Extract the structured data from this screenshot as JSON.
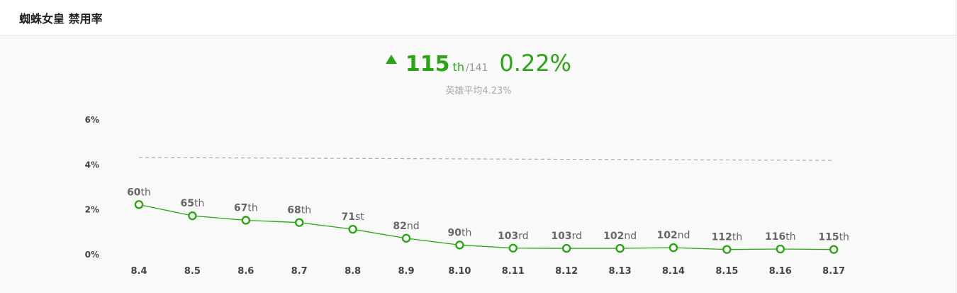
{
  "header": {
    "title": "蜘蛛女皇 禁用率"
  },
  "summary": {
    "rank": "115",
    "rank_suffix": "th",
    "total": "/141",
    "rate": "0.22%",
    "average": "英雄平均4.23%",
    "trend_icon": "up-triangle-icon",
    "accent_color": "#2aa514"
  },
  "chart_data": {
    "type": "line",
    "categories": [
      "8.4",
      "8.5",
      "8.6",
      "8.7",
      "8.8",
      "8.9",
      "8.10",
      "8.11",
      "8.12",
      "8.13",
      "8.14",
      "8.15",
      "8.16",
      "8.17"
    ],
    "series": [
      {
        "values": [
          2.2,
          1.7,
          1.5,
          1.4,
          1.1,
          0.7,
          0.4,
          0.26,
          0.25,
          0.25,
          0.28,
          0.2,
          0.22,
          0.2
        ],
        "labels": [
          {
            "num": "60",
            "suf": "th"
          },
          {
            "num": "65",
            "suf": "th"
          },
          {
            "num": "67",
            "suf": "th"
          },
          {
            "num": "68",
            "suf": "th"
          },
          {
            "num": "71",
            "suf": "st"
          },
          {
            "num": "82",
            "suf": "nd"
          },
          {
            "num": "90",
            "suf": "th"
          },
          {
            "num": "103",
            "suf": "rd"
          },
          {
            "num": "103",
            "suf": "rd"
          },
          {
            "num": "102",
            "suf": "nd"
          },
          {
            "num": "102",
            "suf": "nd"
          },
          {
            "num": "112",
            "suf": "th"
          },
          {
            "num": "116",
            "suf": "th"
          },
          {
            "num": "115",
            "suf": "th"
          }
        ],
        "color": "#2aa514"
      }
    ],
    "average_line": 4.23,
    "average_color": "#aaaaaa",
    "yticks": [
      "0%",
      "2%",
      "4%",
      "6%"
    ],
    "ytick_values": [
      0,
      2,
      4,
      6
    ],
    "ylim": [
      0,
      6
    ],
    "grid": false
  }
}
